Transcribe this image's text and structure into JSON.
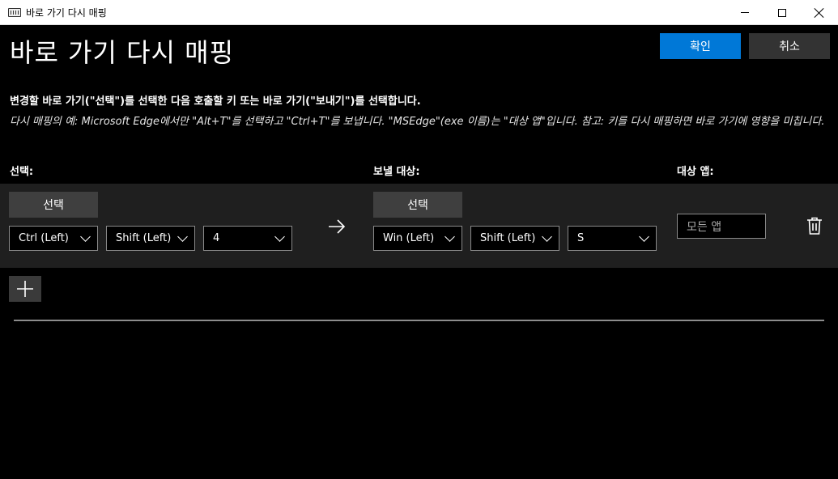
{
  "window": {
    "title": "바로 가기 다시 매핑",
    "icon": "keyboard-icon"
  },
  "header": {
    "title": "바로 가기 다시 매핑",
    "ok_label": "확인",
    "cancel_label": "취소",
    "ok_color": "#0078d7"
  },
  "instruction": "변경할 바로 가기(\"선택\")를 선택한 다음 호출할 키 또는 바로 가기(\"보내기\")를 선택합니다.",
  "example": "다시 매핑의 예: Microsoft Edge에서만 \"Alt+T\"를 선택하고 \"Ctrl+T\"를 보냅니다. \"MSEdge\"(exe 이름)는 \"대상 앱\"입니다. 참고: 키를 다시 매핑하면 바로 가기에 영향을 미칩니다.",
  "columns": {
    "select": "선택:",
    "target": "보낼 대상:",
    "app": "대상 앱:"
  },
  "row": {
    "select_button": "선택",
    "select_keys": [
      "Ctrl (Left)",
      "Shift (Left)",
      "4"
    ],
    "target_button": "선택",
    "target_keys": [
      "Win (Left)",
      "Shift (Left)",
      "S"
    ],
    "app_placeholder": "모든 앱"
  }
}
